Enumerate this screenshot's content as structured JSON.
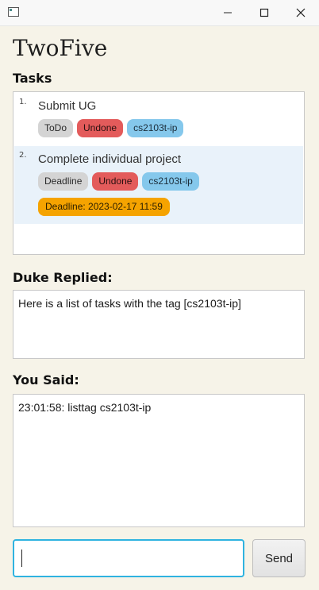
{
  "app": {
    "title": "TwoFive"
  },
  "tasks_section": {
    "label": "Tasks",
    "items": [
      {
        "index": "1.",
        "description": "Submit UG",
        "type": "ToDo",
        "status": "Undone",
        "tags": [
          "cs2103t-ip"
        ],
        "deadline": ""
      },
      {
        "index": "2.",
        "description": "Complete individual project",
        "type": "Deadline",
        "status": "Undone",
        "tags": [
          "cs2103t-ip"
        ],
        "deadline": "Deadline: 2023-02-17 11:59"
      }
    ]
  },
  "duke_section": {
    "label": "Duke Replied:",
    "text": "Here is a list of tasks with the tag [cs2103t-ip]"
  },
  "user_section": {
    "label": "You Said:",
    "text": "23:01:58: listtag cs2103t-ip"
  },
  "input": {
    "value": "",
    "placeholder": ""
  },
  "send_button": {
    "label": "Send"
  },
  "colors": {
    "accent": "#2fb3e0",
    "status_undone": "#e35b5b",
    "tag": "#85c8ec",
    "deadline": "#f5a300",
    "selected_row": "#e9f2fa"
  },
  "icons": {
    "window": "app-window-icon",
    "minimize": "minimize-icon",
    "maximize": "maximize-icon",
    "close": "close-icon"
  }
}
